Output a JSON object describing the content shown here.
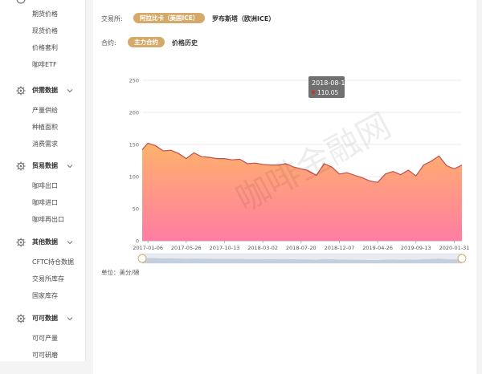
{
  "sidebar": {
    "items_top": [
      "期货价格",
      "现货价格",
      "价格套利",
      "咖啡ETF"
    ],
    "sections": [
      {
        "label": "供需数据",
        "icon": "gear-icon",
        "items": [
          "产量供给",
          "种植面积",
          "消费需求"
        ]
      },
      {
        "label": "贸易数据",
        "icon": "gear-icon",
        "items": [
          "咖啡出口",
          "咖啡进口",
          "咖啡再出口"
        ]
      },
      {
        "label": "其他数据",
        "icon": "gear-icon",
        "items": [
          "CFTC持仓数据",
          "交易所库存",
          "国家库存"
        ]
      },
      {
        "label": "可可数据",
        "icon": "gear-icon",
        "items": [
          "可可产量",
          "可可研磨"
        ]
      }
    ]
  },
  "filters": {
    "exchange_label": "交易所:",
    "exchange_options": [
      "阿拉比卡（美国ICE）",
      "罗布斯塔（欧洲ICE）"
    ],
    "contract_label": "合约:",
    "contract_options": [
      "主力合约",
      "价格历史"
    ]
  },
  "tooltip": {
    "date": "2018-08-10",
    "value": "110.05"
  },
  "unit_label": "单位：美分/磅",
  "watermark": "咖啡金融网",
  "colors": {
    "accent": "#d4a96a",
    "line": "#c0504d",
    "area_top": "#ffb26b",
    "area_bottom": "#ff7da2"
  },
  "chart_data": {
    "type": "area",
    "ylim": [
      0,
      250
    ],
    "y_ticks": [
      0,
      50,
      100,
      150,
      200,
      250
    ],
    "x_ticks": [
      "2017-01-06",
      "2017-05-26",
      "2017-10-13",
      "2018-03-02",
      "2018-07-20",
      "2018-12-07",
      "2019-04-26",
      "2019-09-13",
      "2020-01-31"
    ],
    "x": [
      "2016-12-16",
      "2017-01-06",
      "2017-02-03",
      "2017-03-03",
      "2017-03-31",
      "2017-04-28",
      "2017-05-26",
      "2017-06-23",
      "2017-07-21",
      "2017-08-18",
      "2017-09-15",
      "2017-10-13",
      "2017-11-10",
      "2017-12-08",
      "2018-01-05",
      "2018-02-02",
      "2018-03-02",
      "2018-03-30",
      "2018-04-27",
      "2018-05-25",
      "2018-06-22",
      "2018-07-20",
      "2018-08-10",
      "2018-09-14",
      "2018-10-12",
      "2018-11-09",
      "2018-12-07",
      "2019-01-04",
      "2019-02-01",
      "2019-03-01",
      "2019-03-29",
      "2019-04-26",
      "2019-05-24",
      "2019-06-21",
      "2019-07-19",
      "2019-08-16",
      "2019-09-13",
      "2019-10-11",
      "2019-11-08",
      "2019-12-06",
      "2020-01-03",
      "2020-01-31",
      "2020-02-28"
    ],
    "values": [
      142,
      152,
      148,
      140,
      141,
      136,
      128,
      137,
      131,
      130,
      128,
      128,
      126,
      127,
      120,
      121,
      119,
      118,
      118,
      120,
      115,
      112,
      110.05,
      102,
      120,
      115,
      104,
      106,
      102,
      98,
      93,
      91,
      104,
      108,
      103,
      110,
      101,
      118,
      124,
      132,
      117,
      112,
      118
    ]
  }
}
